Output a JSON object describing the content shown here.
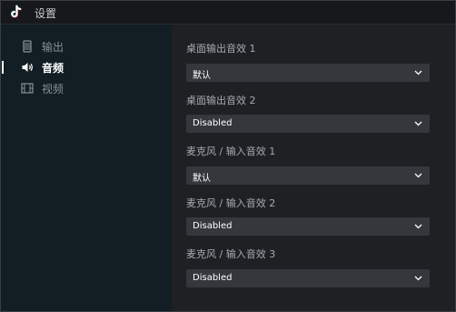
{
  "window": {
    "title": "设置",
    "app_icon": "tiktok-logo-icon"
  },
  "sidebar": {
    "items": [
      {
        "label": "输出",
        "icon": "output-icon",
        "active": false
      },
      {
        "label": "音频",
        "icon": "speaker-icon",
        "active": true
      },
      {
        "label": "视频",
        "icon": "film-icon",
        "active": false
      }
    ]
  },
  "audio_settings": {
    "groups": [
      {
        "label": "桌面输出音效 1",
        "value": "默认"
      },
      {
        "label": "桌面输出音效 2",
        "value": "Disabled"
      },
      {
        "label": "麦克风 / 输入音效 1",
        "value": "默认"
      },
      {
        "label": "麦克风 / 输入音效 2",
        "value": "Disabled"
      },
      {
        "label": "麦克风 / 输入音效 3",
        "value": "Disabled"
      }
    ]
  },
  "colors": {
    "sidebar_bg": "#121d24",
    "content_bg": "#1e2024",
    "select_bg": "#34373c",
    "accent_cyan": "#25f4ee",
    "accent_pink": "#fe2c55"
  }
}
